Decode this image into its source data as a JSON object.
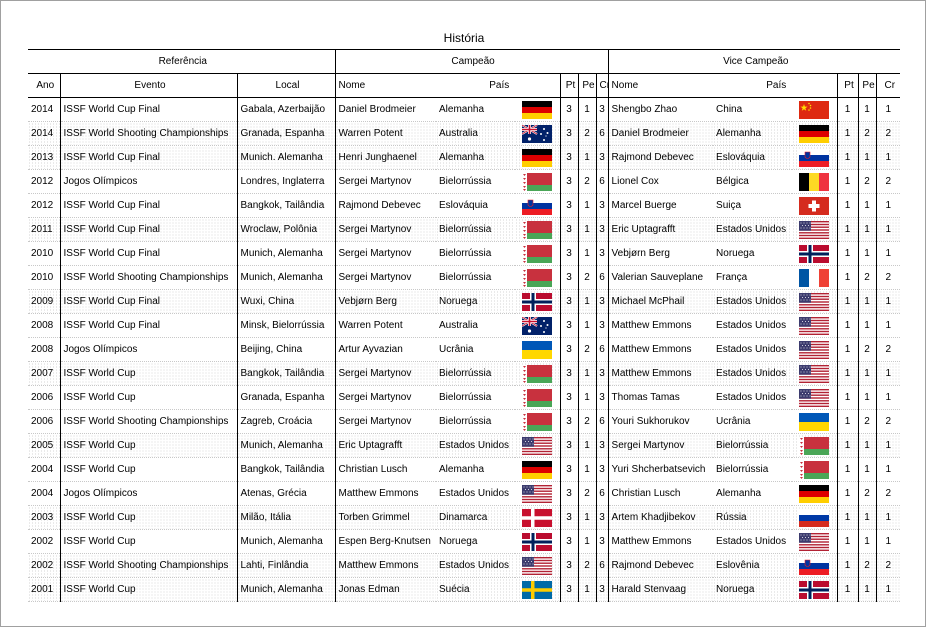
{
  "title": "História",
  "groups": {
    "ref": "Referência",
    "champ": "Campeão",
    "vice": "Vice Campeão"
  },
  "headers": {
    "ano": "Ano",
    "evento": "Evento",
    "local": "Local",
    "nome": "Nome",
    "pais": "País",
    "pt": "Pt",
    "pe": "Pe",
    "cr": "Cr"
  },
  "rows": [
    {
      "ano": "2014",
      "evento": "ISSF World Cup Final",
      "local": "Gabala, Azerbaijão",
      "c_nome": "Daniel Brodmeier",
      "c_pais": "Alemanha",
      "c_flag": "germany",
      "c_pt": "3",
      "c_pe": "1",
      "c_cr": "3",
      "v_nome": "Shengbo Zhao",
      "v_pais": "China",
      "v_flag": "china",
      "v_pt": "1",
      "v_pe": "1",
      "v_cr": "1"
    },
    {
      "ano": "2014",
      "evento": "ISSF World Shooting Championships",
      "local": "Granada, Espanha",
      "c_nome": "Warren Potent",
      "c_pais": "Australia",
      "c_flag": "australia",
      "c_pt": "3",
      "c_pe": "2",
      "c_cr": "6",
      "v_nome": "Daniel Brodmeier",
      "v_pais": "Alemanha",
      "v_flag": "germany",
      "v_pt": "1",
      "v_pe": "2",
      "v_cr": "2"
    },
    {
      "ano": "2013",
      "evento": "ISSF World Cup Final",
      "local": "Munich. Alemanha",
      "c_nome": "Henri Junghaenel",
      "c_pais": "Alemanha",
      "c_flag": "germany",
      "c_pt": "3",
      "c_pe": "1",
      "c_cr": "3",
      "v_nome": "Rajmond Debevec",
      "v_pais": "Eslováquia",
      "v_flag": "slovenia",
      "v_pt": "1",
      "v_pe": "1",
      "v_cr": "1"
    },
    {
      "ano": "2012",
      "evento": "Jogos Olímpicos",
      "local": "Londres, Inglaterra",
      "c_nome": "Sergei Martynov",
      "c_pais": "Bielorrússia",
      "c_flag": "belarus",
      "c_pt": "3",
      "c_pe": "2",
      "c_cr": "6",
      "v_nome": "Lionel Cox",
      "v_pais": "Bélgica",
      "v_flag": "belgium",
      "v_pt": "1",
      "v_pe": "2",
      "v_cr": "2"
    },
    {
      "ano": "2012",
      "evento": "ISSF World Cup Final",
      "local": "Bangkok, Tailândia",
      "c_nome": "Rajmond Debevec",
      "c_pais": "Eslováquia",
      "c_flag": "slovenia",
      "c_pt": "3",
      "c_pe": "1",
      "c_cr": "3",
      "v_nome": "Marcel Buerge",
      "v_pais": "Suiça",
      "v_flag": "switzerland",
      "v_pt": "1",
      "v_pe": "1",
      "v_cr": "1"
    },
    {
      "ano": "2011",
      "evento": "ISSF World Cup Final",
      "local": "Wroclaw, Polônia",
      "c_nome": "Sergei Martynov",
      "c_pais": "Bielorrússia",
      "c_flag": "belarus",
      "c_pt": "3",
      "c_pe": "1",
      "c_cr": "3",
      "v_nome": "Eric Uptagrafft",
      "v_pais": "Estados Unidos",
      "v_flag": "usa",
      "v_pt": "1",
      "v_pe": "1",
      "v_cr": "1"
    },
    {
      "ano": "2010",
      "evento": "ISSF World Cup Final",
      "local": "Munich, Alemanha",
      "c_nome": "Sergei Martynov",
      "c_pais": "Bielorrússia",
      "c_flag": "belarus",
      "c_pt": "3",
      "c_pe": "1",
      "c_cr": "3",
      "v_nome": "Vebjørn Berg",
      "v_pais": "Noruega",
      "v_flag": "norway",
      "v_pt": "1",
      "v_pe": "1",
      "v_cr": "1"
    },
    {
      "ano": "2010",
      "evento": "ISSF World Shooting Championships",
      "local": "Munich, Alemanha",
      "c_nome": "Sergei Martynov",
      "c_pais": "Bielorrússia",
      "c_flag": "belarus",
      "c_pt": "3",
      "c_pe": "2",
      "c_cr": "6",
      "v_nome": "Valerian Sauveplane",
      "v_pais": "França",
      "v_flag": "france",
      "v_pt": "1",
      "v_pe": "2",
      "v_cr": "2"
    },
    {
      "ano": "2009",
      "evento": "ISSF World Cup Final",
      "local": "Wuxi, China",
      "c_nome": "Vebjørn Berg",
      "c_pais": "Noruega",
      "c_flag": "norway",
      "c_pt": "3",
      "c_pe": "1",
      "c_cr": "3",
      "v_nome": "Michael McPhail",
      "v_pais": "Estados Unidos",
      "v_flag": "usa",
      "v_pt": "1",
      "v_pe": "1",
      "v_cr": "1"
    },
    {
      "ano": "2008",
      "evento": "ISSF World Cup Final",
      "local": "Minsk, Bielorrússia",
      "c_nome": "Warren Potent",
      "c_pais": "Australia",
      "c_flag": "australia",
      "c_pt": "3",
      "c_pe": "1",
      "c_cr": "3",
      "v_nome": "Matthew Emmons",
      "v_pais": "Estados Unidos",
      "v_flag": "usa",
      "v_pt": "1",
      "v_pe": "1",
      "v_cr": "1"
    },
    {
      "ano": "2008",
      "evento": "Jogos Olímpicos",
      "local": "Beijing, China",
      "c_nome": "Artur Ayvazian",
      "c_pais": "Ucrânia",
      "c_flag": "ukraine",
      "c_pt": "3",
      "c_pe": "2",
      "c_cr": "6",
      "v_nome": "Matthew Emmons",
      "v_pais": "Estados Unidos",
      "v_flag": "usa",
      "v_pt": "1",
      "v_pe": "2",
      "v_cr": "2"
    },
    {
      "ano": "2007",
      "evento": "ISSF World Cup",
      "local": "Bangkok, Tailândia",
      "c_nome": "Sergei Martynov",
      "c_pais": "Bielorrússia",
      "c_flag": "belarus",
      "c_pt": "3",
      "c_pe": "1",
      "c_cr": "3",
      "v_nome": "Matthew Emmons",
      "v_pais": "Estados Unidos",
      "v_flag": "usa",
      "v_pt": "1",
      "v_pe": "1",
      "v_cr": "1"
    },
    {
      "ano": "2006",
      "evento": "ISSF World Cup",
      "local": "Granada, Espanha",
      "c_nome": "Sergei Martynov",
      "c_pais": "Bielorrússia",
      "c_flag": "belarus",
      "c_pt": "3",
      "c_pe": "1",
      "c_cr": "3",
      "v_nome": "Thomas Tamas",
      "v_pais": "Estados Unidos",
      "v_flag": "usa",
      "v_pt": "1",
      "v_pe": "1",
      "v_cr": "1"
    },
    {
      "ano": "2006",
      "evento": "ISSF World Shooting Championships",
      "local": "Zagreb, Croácia",
      "c_nome": "Sergei Martynov",
      "c_pais": "Bielorrússia",
      "c_flag": "belarus",
      "c_pt": "3",
      "c_pe": "2",
      "c_cr": "6",
      "v_nome": "Youri Sukhorukov",
      "v_pais": "Ucrânia",
      "v_flag": "ukraine",
      "v_pt": "1",
      "v_pe": "2",
      "v_cr": "2"
    },
    {
      "ano": "2005",
      "evento": "ISSF World Cup",
      "local": "Munich, Alemanha",
      "c_nome": "Eric Uptagrafft",
      "c_pais": "Estados Unidos",
      "c_flag": "usa",
      "c_pt": "3",
      "c_pe": "1",
      "c_cr": "3",
      "v_nome": "Sergei Martynov",
      "v_pais": "Bielorrússia",
      "v_flag": "belarus",
      "v_pt": "1",
      "v_pe": "1",
      "v_cr": "1"
    },
    {
      "ano": "2004",
      "evento": "ISSF World Cup",
      "local": "Bangkok, Tailândia",
      "c_nome": "Christian Lusch",
      "c_pais": "Alemanha",
      "c_flag": "germany",
      "c_pt": "3",
      "c_pe": "1",
      "c_cr": "3",
      "v_nome": "Yuri Shcherbatsevich",
      "v_pais": "Bielorrússia",
      "v_flag": "belarus",
      "v_pt": "1",
      "v_pe": "1",
      "v_cr": "1"
    },
    {
      "ano": "2004",
      "evento": "Jogos Olímpicos",
      "local": "Atenas, Grécia",
      "c_nome": "Matthew Emmons",
      "c_pais": "Estados Unidos",
      "c_flag": "usa",
      "c_pt": "3",
      "c_pe": "2",
      "c_cr": "6",
      "v_nome": "Christian Lusch",
      "v_pais": "Alemanha",
      "v_flag": "germany",
      "v_pt": "1",
      "v_pe": "2",
      "v_cr": "2"
    },
    {
      "ano": "2003",
      "evento": "ISSF World Cup",
      "local": "Milão, Itália",
      "c_nome": "Torben Grimmel",
      "c_pais": "Dinamarca",
      "c_flag": "denmark",
      "c_pt": "3",
      "c_pe": "1",
      "c_cr": "3",
      "v_nome": "Artem Khadjibekov",
      "v_pais": "Rússia",
      "v_flag": "russia",
      "v_pt": "1",
      "v_pe": "1",
      "v_cr": "1"
    },
    {
      "ano": "2002",
      "evento": "ISSF World Cup",
      "local": "Munich, Alemanha",
      "c_nome": "Espen Berg-Knutsen",
      "c_pais": "Noruega",
      "c_flag": "norway",
      "c_pt": "3",
      "c_pe": "1",
      "c_cr": "3",
      "v_nome": "Matthew Emmons",
      "v_pais": "Estados Unidos",
      "v_flag": "usa",
      "v_pt": "1",
      "v_pe": "1",
      "v_cr": "1"
    },
    {
      "ano": "2002",
      "evento": "ISSF World Shooting Championships",
      "local": "Lahti, Finlândia",
      "c_nome": "Matthew Emmons",
      "c_pais": "Estados Unidos",
      "c_flag": "usa",
      "c_pt": "3",
      "c_pe": "2",
      "c_cr": "6",
      "v_nome": "Rajmond Debevec",
      "v_pais": "Eslovênia",
      "v_flag": "slovenia",
      "v_pt": "1",
      "v_pe": "2",
      "v_cr": "2"
    },
    {
      "ano": "2001",
      "evento": "ISSF World Cup",
      "local": "Munich, Alemanha",
      "c_nome": "Jonas Edman",
      "c_pais": "Suécia",
      "c_flag": "sweden",
      "c_pt": "3",
      "c_pe": "1",
      "c_cr": "3",
      "v_nome": "Harald Stenvaag",
      "v_pais": "Noruega",
      "v_flag": "norway",
      "v_pt": "1",
      "v_pe": "1",
      "v_cr": "1"
    }
  ]
}
